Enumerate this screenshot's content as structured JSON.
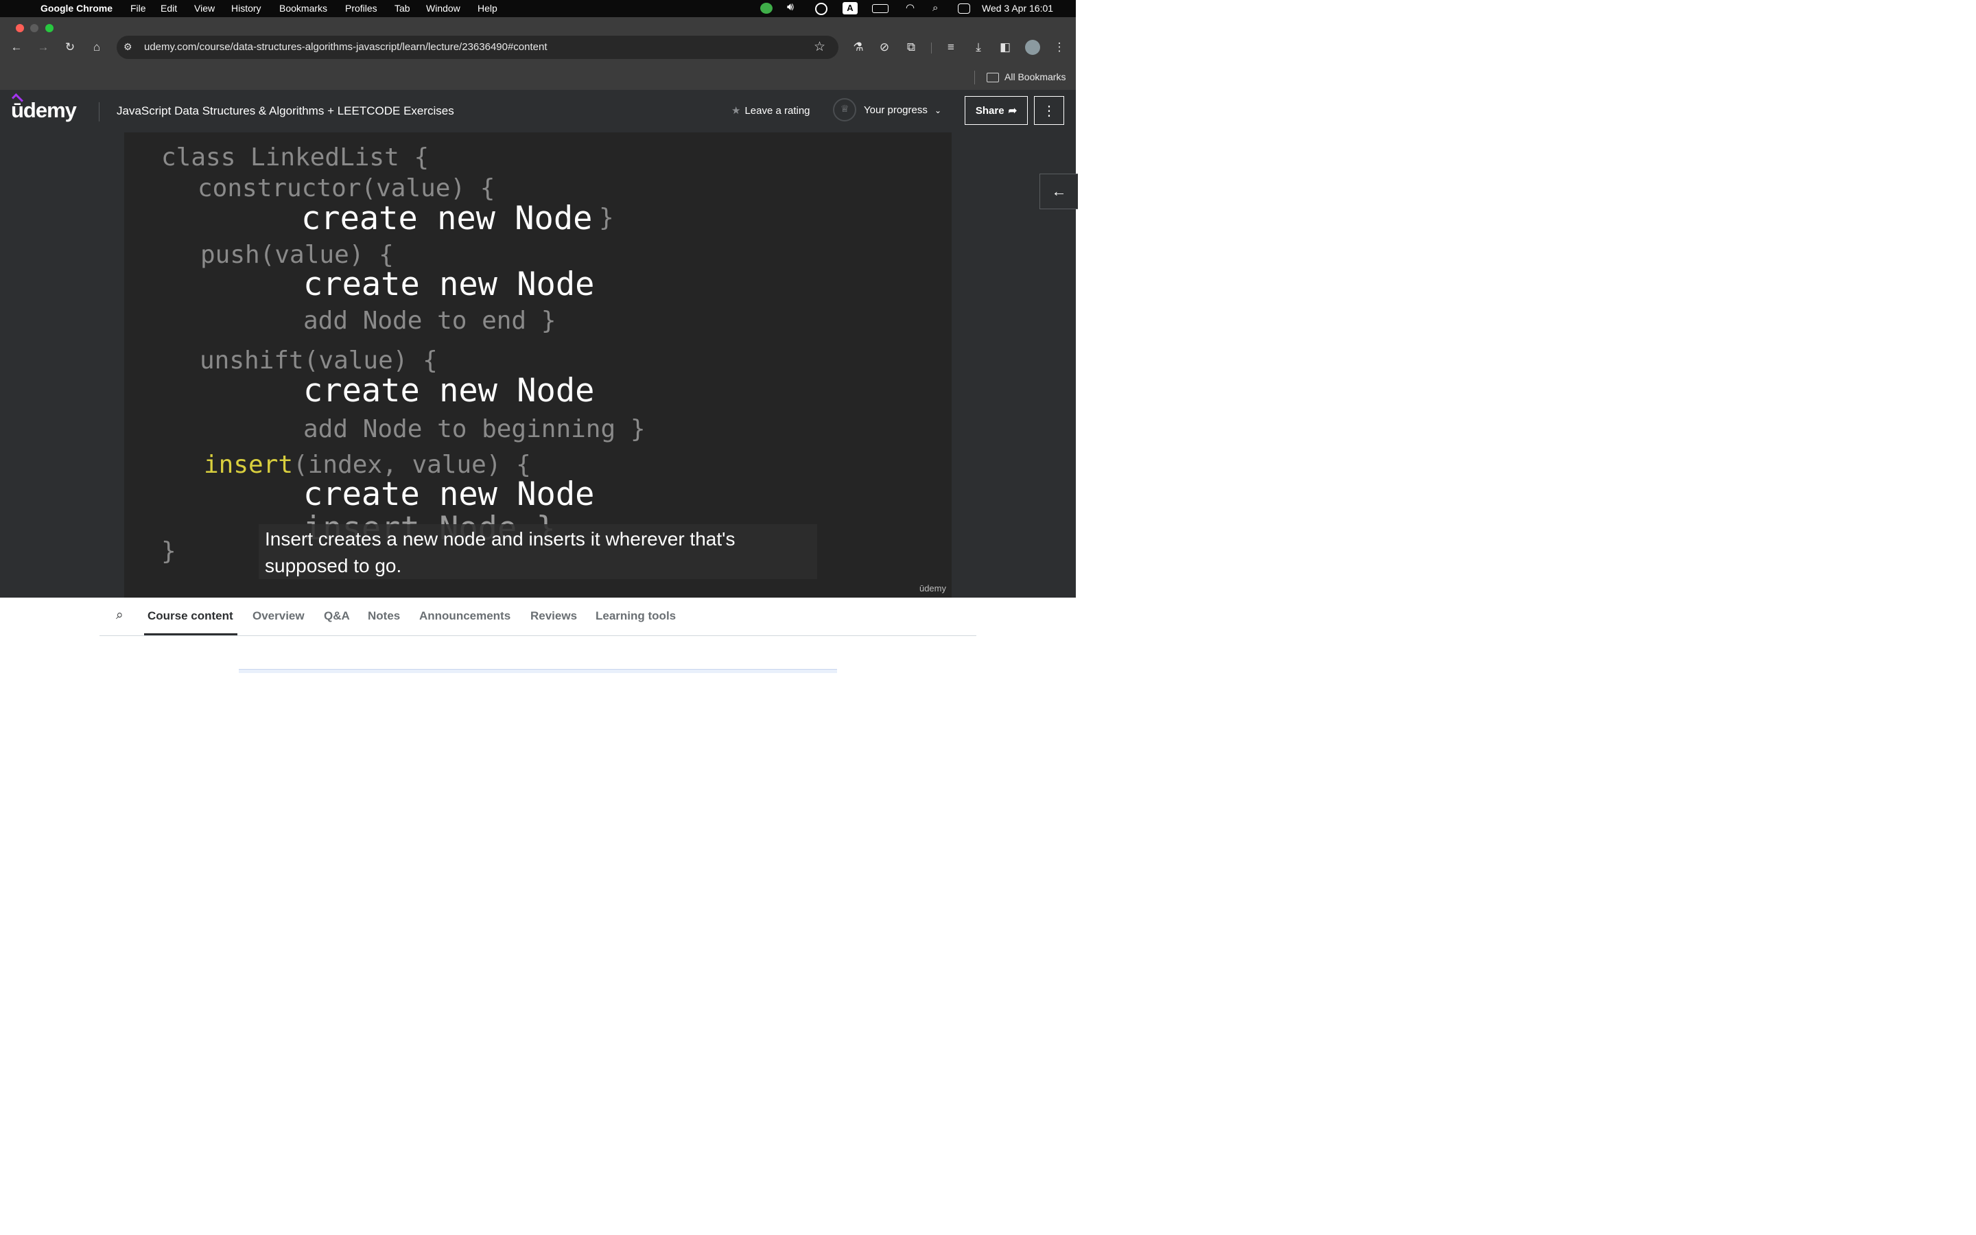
{
  "menubar": {
    "app": "Google Chrome",
    "items": [
      "File",
      "Edit",
      "View",
      "History",
      "Bookmarks",
      "Profiles",
      "Tab",
      "Window",
      "Help"
    ],
    "datetime": "Wed 3 Apr  16:01",
    "input_indicator": "A"
  },
  "browser": {
    "url": "udemy.com/course/data-structures-algorithms-javascript/learn/lecture/23636490#content",
    "bookmarks_label": "All Bookmarks"
  },
  "header": {
    "logo": "ūdemy",
    "course_title": "JavaScript Data Structures & Algorithms + LEETCODE Exercises",
    "rating_label": "Leave a rating",
    "progress_label": "Your progress",
    "share_label": "Share"
  },
  "video": {
    "code_lines": {
      "class_open": "class LinkedList {",
      "constructor_sig": "constructor(value) {",
      "constructor_body": "create new Node",
      "constructor_close": "}",
      "push_sig": "push(value) {",
      "push_create": "create new Node",
      "push_add": "add Node to end }",
      "unshift_sig": "unshift(value) {",
      "unshift_create": "create new Node",
      "unshift_add": "add Node to beginning }",
      "insert_kw": "insert",
      "insert_args": "(index, value) {",
      "insert_create": "create new Node",
      "insert_node": "insert Node }",
      "class_close": "}"
    },
    "caption": "Insert creates a new node and inserts it wherever that's supposed to go.",
    "watermark": "ūdemy"
  },
  "tabs": [
    "Course content",
    "Overview",
    "Q&A",
    "Notes",
    "Announcements",
    "Reviews",
    "Learning tools"
  ],
  "colors": {
    "accent": "#a435f0",
    "header_bg": "#2d2f31",
    "highlight": "#d9cf3e"
  }
}
